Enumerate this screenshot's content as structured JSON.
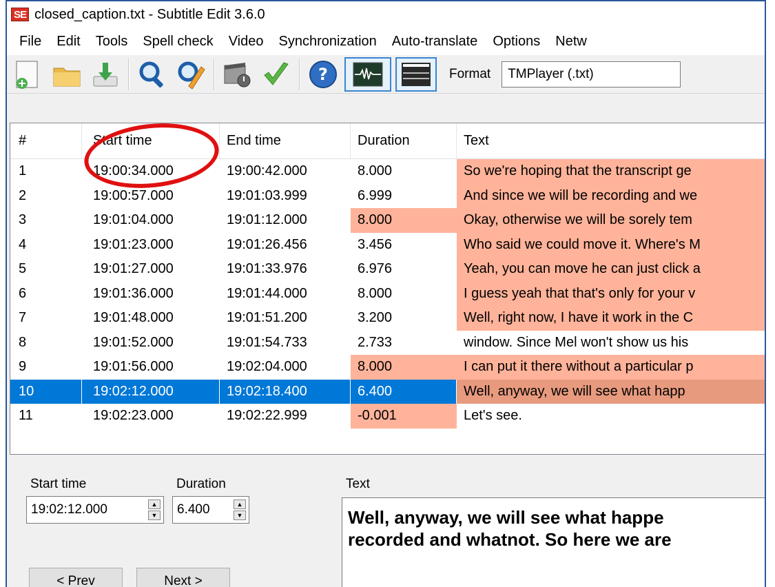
{
  "window": {
    "title": "closed_caption.txt - Subtitle Edit 3.6.0",
    "logo_text": "SE"
  },
  "menu": [
    "File",
    "Edit",
    "Tools",
    "Spell check",
    "Video",
    "Synchronization",
    "Auto-translate",
    "Options",
    "Netw"
  ],
  "toolbar": {
    "icons": [
      "new-file-icon",
      "open-folder-icon",
      "download-save-icon",
      "find-icon",
      "replace-icon",
      "visual-sync-icon",
      "spell-check-icon",
      "help-icon",
      "waveform-icon",
      "video-icon"
    ],
    "format_label": "Format",
    "format_value": "TMPlayer (.txt)"
  },
  "grid": {
    "columns": [
      "#",
      "Start time",
      "End time",
      "Duration",
      "Text"
    ],
    "rows": [
      {
        "num": "1",
        "start": "19:00:34.000",
        "end": "19:00:42.000",
        "dur": "8.000",
        "text": "So we're hoping that the transcript ge",
        "dur_warn": false,
        "text_warn": true
      },
      {
        "num": "2",
        "start": "19:00:57.000",
        "end": "19:01:03.999",
        "dur": "6.999",
        "text": "And since we will be recording and we",
        "dur_warn": false,
        "text_warn": true
      },
      {
        "num": "3",
        "start": "19:01:04.000",
        "end": "19:01:12.000",
        "dur": "8.000",
        "text": "Okay, otherwise we will be sorely tem",
        "dur_warn": true,
        "text_warn": true
      },
      {
        "num": "4",
        "start": "19:01:23.000",
        "end": "19:01:26.456",
        "dur": "3.456",
        "text": "Who said we could move it. Where's M",
        "dur_warn": false,
        "text_warn": true
      },
      {
        "num": "5",
        "start": "19:01:27.000",
        "end": "19:01:33.976",
        "dur": "6.976",
        "text": "Yeah, you can move he can just click a",
        "dur_warn": false,
        "text_warn": true
      },
      {
        "num": "6",
        "start": "19:01:36.000",
        "end": "19:01:44.000",
        "dur": "8.000",
        "text": "I guess yeah that that's only for your v",
        "dur_warn": false,
        "text_warn": true
      },
      {
        "num": "7",
        "start": "19:01:48.000",
        "end": "19:01:51.200",
        "dur": "3.200",
        "text": "Well, right now, I have it work in the C",
        "dur_warn": false,
        "text_warn": true
      },
      {
        "num": "8",
        "start": "19:01:52.000",
        "end": "19:01:54.733",
        "dur": "2.733",
        "text": "window. Since Mel won't show us his",
        "dur_warn": false,
        "text_warn": false
      },
      {
        "num": "9",
        "start": "19:01:56.000",
        "end": "19:02:04.000",
        "dur": "8.000",
        "text": "I can put it there without a particular p",
        "dur_warn": true,
        "text_warn": true
      },
      {
        "num": "10",
        "start": "19:02:12.000",
        "end": "19:02:18.400",
        "dur": "6.400",
        "text": "Well, anyway, we will see what happ",
        "dur_warn": false,
        "text_warn": true,
        "selected": true
      },
      {
        "num": "11",
        "start": "19:02:23.000",
        "end": "19:02:22.999",
        "dur": "-0.001",
        "text": "Let's see.",
        "dur_warn": true,
        "text_warn": false
      }
    ]
  },
  "editor": {
    "start_label": "Start time",
    "start_value": "19:02:12.000",
    "duration_label": "Duration",
    "duration_value": "6.400",
    "text_label": "Text",
    "text_line1": "Well, anyway, we will see what happe",
    "text_line2": "recorded and whatnot. So here we are",
    "prev_label": "< Prev",
    "next_label": "Next >"
  },
  "colors": {
    "selection": "#0078d7",
    "warning": "#ffb39a",
    "annotation": "#e01010"
  }
}
